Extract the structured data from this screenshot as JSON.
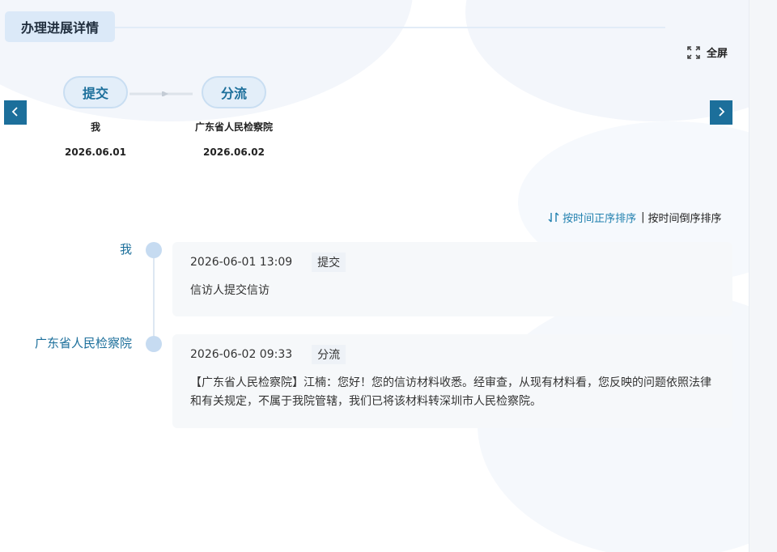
{
  "section": {
    "title": "办理进展详情"
  },
  "toolbar": {
    "fullscreen_label": "全屏"
  },
  "steps": [
    {
      "label": "提交",
      "who": "我",
      "date": "2026.06.01"
    },
    {
      "label": "分流",
      "who": "广东省人民检察院",
      "date": "2026.06.02"
    }
  ],
  "sort": {
    "asc_label": "按时间正序排序",
    "separator": "|",
    "desc_label": "按时间倒序排序"
  },
  "timeline": [
    {
      "name": "我",
      "datetime": "2026-06-01 13:09",
      "tag": "提交",
      "content": "信访人提交信访"
    },
    {
      "name": "广东省人民检察院",
      "datetime": "2026-06-02 09:33",
      "tag": "分流",
      "content": "【广东省人民检察院】江楠：您好！您的信访材料收悉。经审查，从现有材料看，您反映的问题依照法律和有关规定，不属于我院管辖，我们已将该材料转深圳市人民检察院。"
    }
  ],
  "colors": {
    "accent": "#1c6f9b",
    "pill_bg": "#e3eef9",
    "title_bg": "#dbe9f8",
    "dot": "#c6dbf1"
  },
  "icons": {
    "prev": "chevron-left-icon",
    "next": "chevron-right-icon",
    "fullscreen": "expand-icon",
    "sort": "sort-arrows-icon",
    "connector": "arrow-right-icon"
  }
}
